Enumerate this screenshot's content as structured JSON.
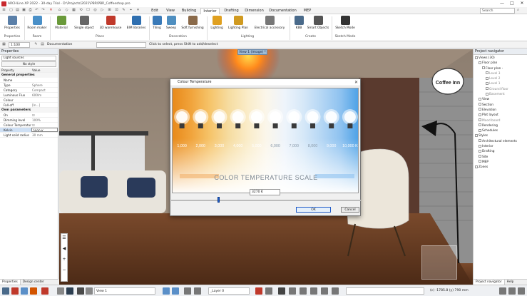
{
  "window": {
    "title": "ARCHLine.XP 2022 - 30-day Trial - D:\\Projects\\2021\\PBR\\PBR_Coffeeshop.pro",
    "controls": {
      "minimize": "—",
      "maximize": "□",
      "close": "✕"
    }
  },
  "ribbon_tabs": [
    "Edit",
    "View",
    "Building",
    "Interior",
    "Drafting",
    "Dimension",
    "Documentation",
    "MEP"
  ],
  "active_tab": "Interior",
  "search": {
    "placeholder": "Search"
  },
  "ribbon": {
    "buttons": [
      {
        "label": "Properties",
        "icon": "properties-icon",
        "color": "#5a7fa8"
      },
      {
        "label": "Room maker",
        "icon": "room-maker-icon",
        "color": "#4a90c8"
      },
      {
        "label": "Material",
        "icon": "material-icon",
        "color": "#6a9a3a"
      },
      {
        "label": "Single object",
        "icon": "single-object-icon",
        "color": "#666666"
      },
      {
        "label": "3D warehouse",
        "icon": "warehouse-icon",
        "color": "#c0392b"
      },
      {
        "label": "BIM libraries",
        "icon": "bim-libraries-icon",
        "color": "#2f6fb0"
      },
      {
        "label": "Tiling",
        "icon": "tiling-icon",
        "color": "#3a7ab8"
      },
      {
        "label": "Sweep",
        "icon": "sweep-icon",
        "color": "#4f8fc0"
      },
      {
        "label": "Soft furnishing",
        "icon": "soft-furnishing-icon",
        "color": "#8a6a4a"
      },
      {
        "label": "Lighting",
        "icon": "lighting-icon",
        "color": "#e0a020"
      },
      {
        "label": "Lighting Plan",
        "icon": "lighting-plan-icon",
        "color": "#d09a20"
      },
      {
        "label": "Electrical accessory",
        "icon": "electrical-icon",
        "color": "#777777"
      },
      {
        "label": "KBB",
        "icon": "kbb-icon",
        "color": "#4a6a8a"
      },
      {
        "label": "Smart Objects",
        "icon": "smart-objects-icon",
        "color": "#555555"
      },
      {
        "label": "Sketch Mode",
        "icon": "sketch-mode-icon",
        "color": "#333333"
      }
    ],
    "groups": [
      "Properties",
      "Room",
      "Place",
      "Decoration",
      "Lighting",
      "Create",
      "Sketch Mode"
    ]
  },
  "toolbar2": {
    "scale": "1:100",
    "documentation": "Documentation",
    "hint": "Click to select, press Shift to add/deselect"
  },
  "properties_panel": {
    "title": "Properties",
    "filter": "Light sources",
    "style_button": "No style",
    "col_property": "Property",
    "col_value": "Value",
    "sections": [
      {
        "name": "General properties",
        "rows": [
          {
            "k": "Name",
            "v": ""
          },
          {
            "k": "Type",
            "v": "Sphere"
          },
          {
            "k": "Category",
            "v": "Compact"
          },
          {
            "k": "Luminous Flux",
            "v": "600lm"
          },
          {
            "k": "Colour",
            "v": ""
          },
          {
            "k": "Fall-off",
            "v": "[In...]"
          }
        ]
      },
      {
        "name": "Own parameters",
        "rows": [
          {
            "k": "On",
            "v": "☑"
          },
          {
            "k": "Dimming level",
            "v": "100%"
          },
          {
            "k": "Colour Temperature",
            "v": "☑"
          },
          {
            "k": "Kelvin",
            "v": "3000 K"
          },
          {
            "k": "Light solid radius",
            "v": "30 mm"
          }
        ]
      }
    ],
    "bottom_tabs": [
      "Properties",
      "Design center"
    ]
  },
  "viewport": {
    "tab": "View 1 (Image) *",
    "sign_text": "Coffee Inn"
  },
  "dialog": {
    "title": "Colour Temperature",
    "kelvin_labels": [
      "1,000",
      "2,000",
      "3,000",
      "4,000",
      "5,000",
      "6,000",
      "7,000",
      "8,000",
      "9,000",
      "10,000 K"
    ],
    "scale_title": "COLOR TEMPERATURE SCALE",
    "temperature_value": "3270 K",
    "slider_fraction": 0.25,
    "ok_label": "OK",
    "cancel_label": "Cancel",
    "gradient_colors": [
      "#e88a1a",
      "#f1a43c",
      "#f6c46a",
      "#f6dca0",
      "#faecc8",
      "#fbf6ea",
      "#eef4fb",
      "#d6e8f8",
      "#b4d6f4",
      "#8ec2f0",
      "#4aa0e6"
    ]
  },
  "navigator": {
    "title": "Project navigator",
    "items": [
      {
        "t": "Views (30)",
        "lvl": 0,
        "muted": false
      },
      {
        "t": "Floor plan",
        "lvl": 1,
        "muted": false
      },
      {
        "t": "Floor plan -",
        "lvl": 2,
        "muted": false
      },
      {
        "t": "Level 3",
        "lvl": 3,
        "muted": true
      },
      {
        "t": "Level 2",
        "lvl": 3,
        "muted": true
      },
      {
        "t": "Level 1",
        "lvl": 3,
        "muted": true
      },
      {
        "t": "Ground floor",
        "lvl": 3,
        "muted": true
      },
      {
        "t": "Basement",
        "lvl": 3,
        "muted": true
      },
      {
        "t": "View",
        "lvl": 1,
        "muted": false
      },
      {
        "t": "Section",
        "lvl": 1,
        "muted": false
      },
      {
        "t": "Elevation",
        "lvl": 1,
        "muted": false
      },
      {
        "t": "Plot layout",
        "lvl": 1,
        "muted": false
      },
      {
        "t": "Mood board",
        "lvl": 1,
        "muted": true
      },
      {
        "t": "Rendering",
        "lvl": 1,
        "muted": false
      },
      {
        "t": "Schedules",
        "lvl": 1,
        "muted": false
      },
      {
        "t": "Styles",
        "lvl": 0,
        "muted": false
      },
      {
        "t": "Architectural elements",
        "lvl": 1,
        "muted": false
      },
      {
        "t": "Interior",
        "lvl": 1,
        "muted": false
      },
      {
        "t": "Drafting",
        "lvl": 1,
        "muted": false
      },
      {
        "t": "Site",
        "lvl": 1,
        "muted": false
      },
      {
        "t": "MEP",
        "lvl": 1,
        "muted": false
      },
      {
        "t": "Zones",
        "lvl": 0,
        "muted": false
      }
    ],
    "bottom_tabs": [
      "Project navigator",
      "Help"
    ]
  },
  "statusbar": {
    "view_select": "View 1",
    "layer": "_Layer 0",
    "coords": "(c) -1785.8  (y) 790 mm"
  }
}
